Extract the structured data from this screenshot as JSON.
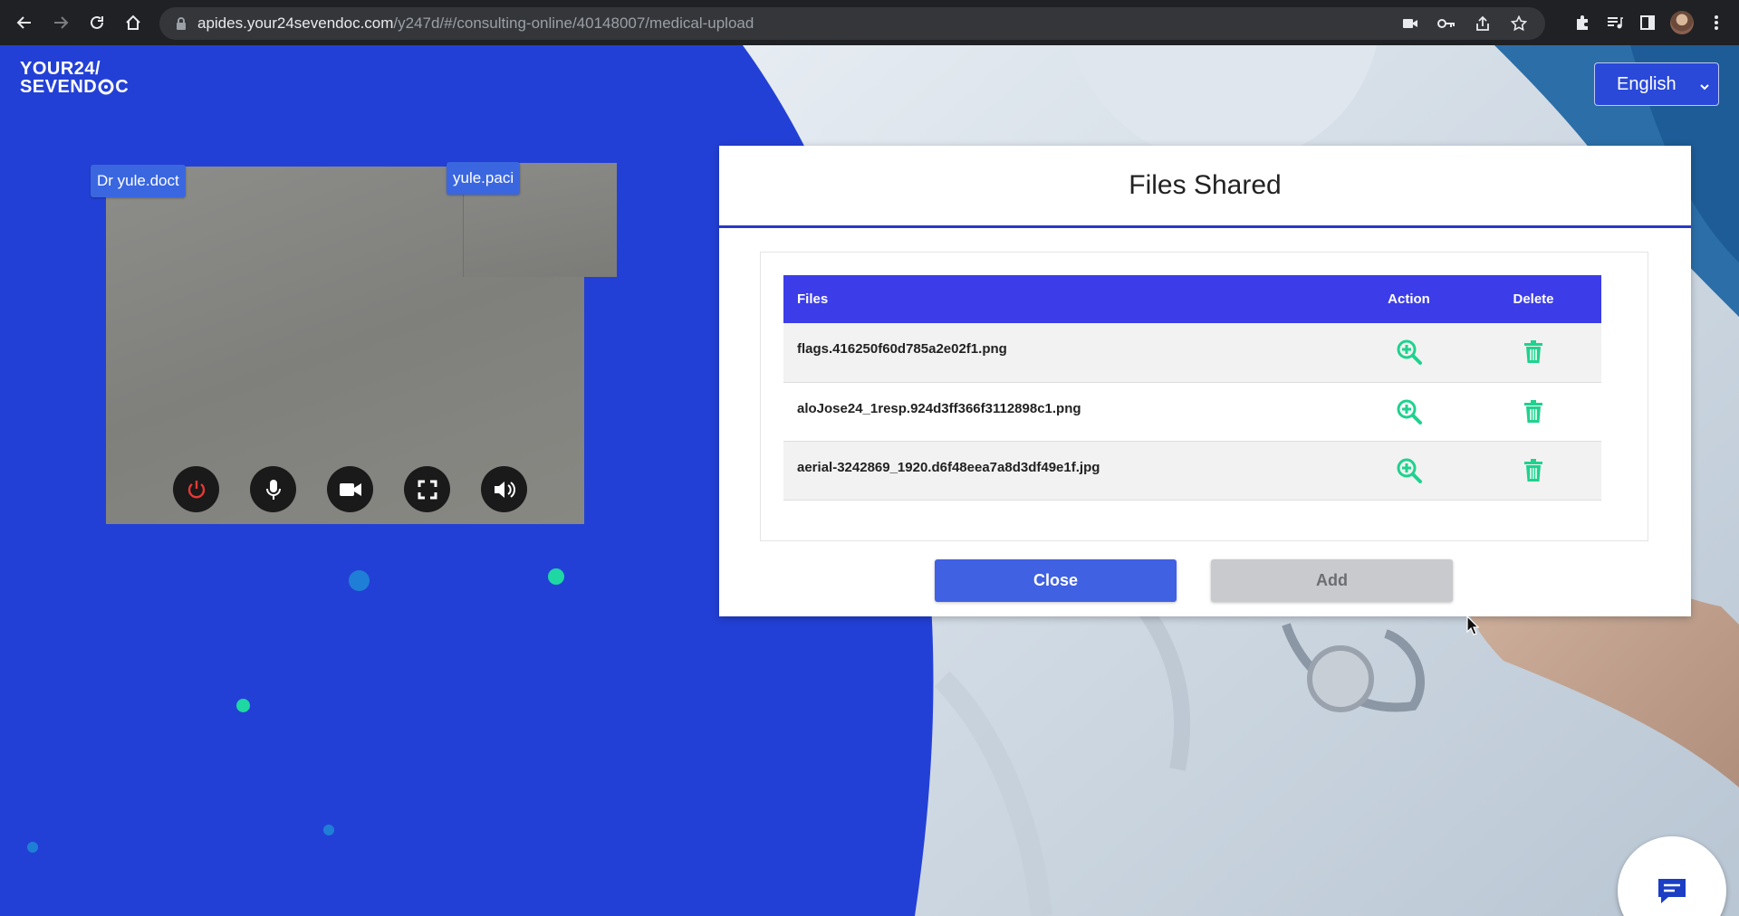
{
  "browser": {
    "url_host": "apides.your24sevendoc.com",
    "url_path": "/y247d/#/consulting-online/40148007/medical-upload"
  },
  "brand": {
    "line1": "YOUR24/",
    "line2_a": "SEVEND",
    "line2_b": "C"
  },
  "language": {
    "selected": "English"
  },
  "video": {
    "doctor_tag": "Dr yule.doct",
    "patient_tag": "yule.paci"
  },
  "modal": {
    "title": "Files Shared",
    "columns": {
      "files": "Files",
      "action": "Action",
      "delete": "Delete"
    },
    "rows": [
      {
        "file": "flags.416250f60d785a2e02f1.png"
      },
      {
        "file": "aloJose24_1resp.924d3ff366f3112898c1.png"
      },
      {
        "file": "aerial-3242869_1920.d6f48eea7a8d3df49e1f.jpg"
      }
    ],
    "close_label": "Close",
    "add_label": "Add"
  },
  "colors": {
    "brand_blue": "#2340d6",
    "table_header": "#3c3de8",
    "action_green": "#1fd28e",
    "close_button": "#3f61e2"
  }
}
